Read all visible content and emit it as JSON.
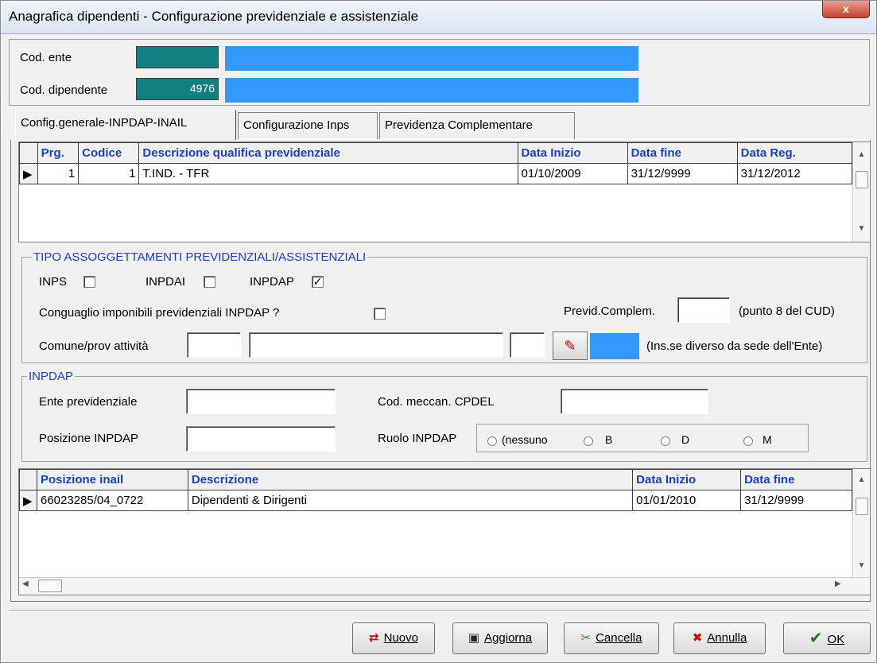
{
  "window": {
    "title": "Anagrafica dipendenti - Configurazione previdenziale e assistenziale",
    "close_label": "x"
  },
  "header": {
    "cod_ente_label": "Cod. ente",
    "cod_ente_value": "",
    "cod_dipendente_label": "Cod. dipendente",
    "cod_dipendente_value": "4976"
  },
  "tabs": [
    {
      "label": "Config.generale-INPDAP-INAIL"
    },
    {
      "label": "Configurazione Inps"
    },
    {
      "label": "Previdenza Complementare"
    }
  ],
  "qualifiche_grid": {
    "columns": [
      "Prg.",
      "Codice",
      "Descrizione qualifica previdenziale",
      "Data Inizio",
      "Data fine",
      "Data Reg."
    ],
    "rows": [
      {
        "prg": "1",
        "codice": "1",
        "descrizione": "T.IND. - TFR",
        "data_inizio": "01/10/2009",
        "data_fine": "31/12/9999",
        "data_reg": "31/12/2012"
      }
    ]
  },
  "tipo_assoggettamenti": {
    "legend": "TIPO ASSOGGETTAMENTI PREVIDENZIALI/ASSISTENZIALI",
    "inps_label": "INPS",
    "inps_checked": false,
    "inpdai_label": "INPDAI",
    "inpdai_checked": false,
    "inpdap_label": "INPDAP",
    "inpdap_checked": true,
    "conguaglio_label": "Conguaglio imponibili previdenziali INPDAP ?",
    "conguaglio_checked": false,
    "previd_label": "Previd.Complem.",
    "previd_value": "",
    "previd_note": "(punto 8 del CUD)",
    "comune_label": "Comune/prov attività",
    "comune_note": "(Ins.se diverso da sede dell'Ente)"
  },
  "inpdap": {
    "legend": "INPDAP",
    "ente_label": "Ente previdenziale",
    "ente_value": "",
    "posizione_label": "Posizione INPDAP",
    "posizione_value": "",
    "cpdel_label": "Cod. meccan. CPDEL",
    "cpdel_value": "",
    "ruolo_label": "Ruolo INPDAP",
    "ruolo_options": [
      "(nessuno",
      "B",
      "D",
      "M"
    ]
  },
  "inail_grid": {
    "columns": [
      "Posizione inail",
      "Descrizione",
      "Data Inizio",
      "Data fine"
    ],
    "rows": [
      {
        "posizione": "66023285/04_0722",
        "descrizione": "Dipendenti & Dirigenti",
        "data_inizio": "01/01/2010",
        "data_fine": "31/12/9999"
      }
    ]
  },
  "buttons": {
    "nuovo": "Nuovo",
    "aggiorna": "Aggiorna",
    "cancella": "Cancella",
    "annulla": "Annulla",
    "ok": "OK"
  },
  "colors": {
    "teal": "#118080",
    "blue_bar": "#3399ff",
    "header_text": "#1a3fc8"
  }
}
